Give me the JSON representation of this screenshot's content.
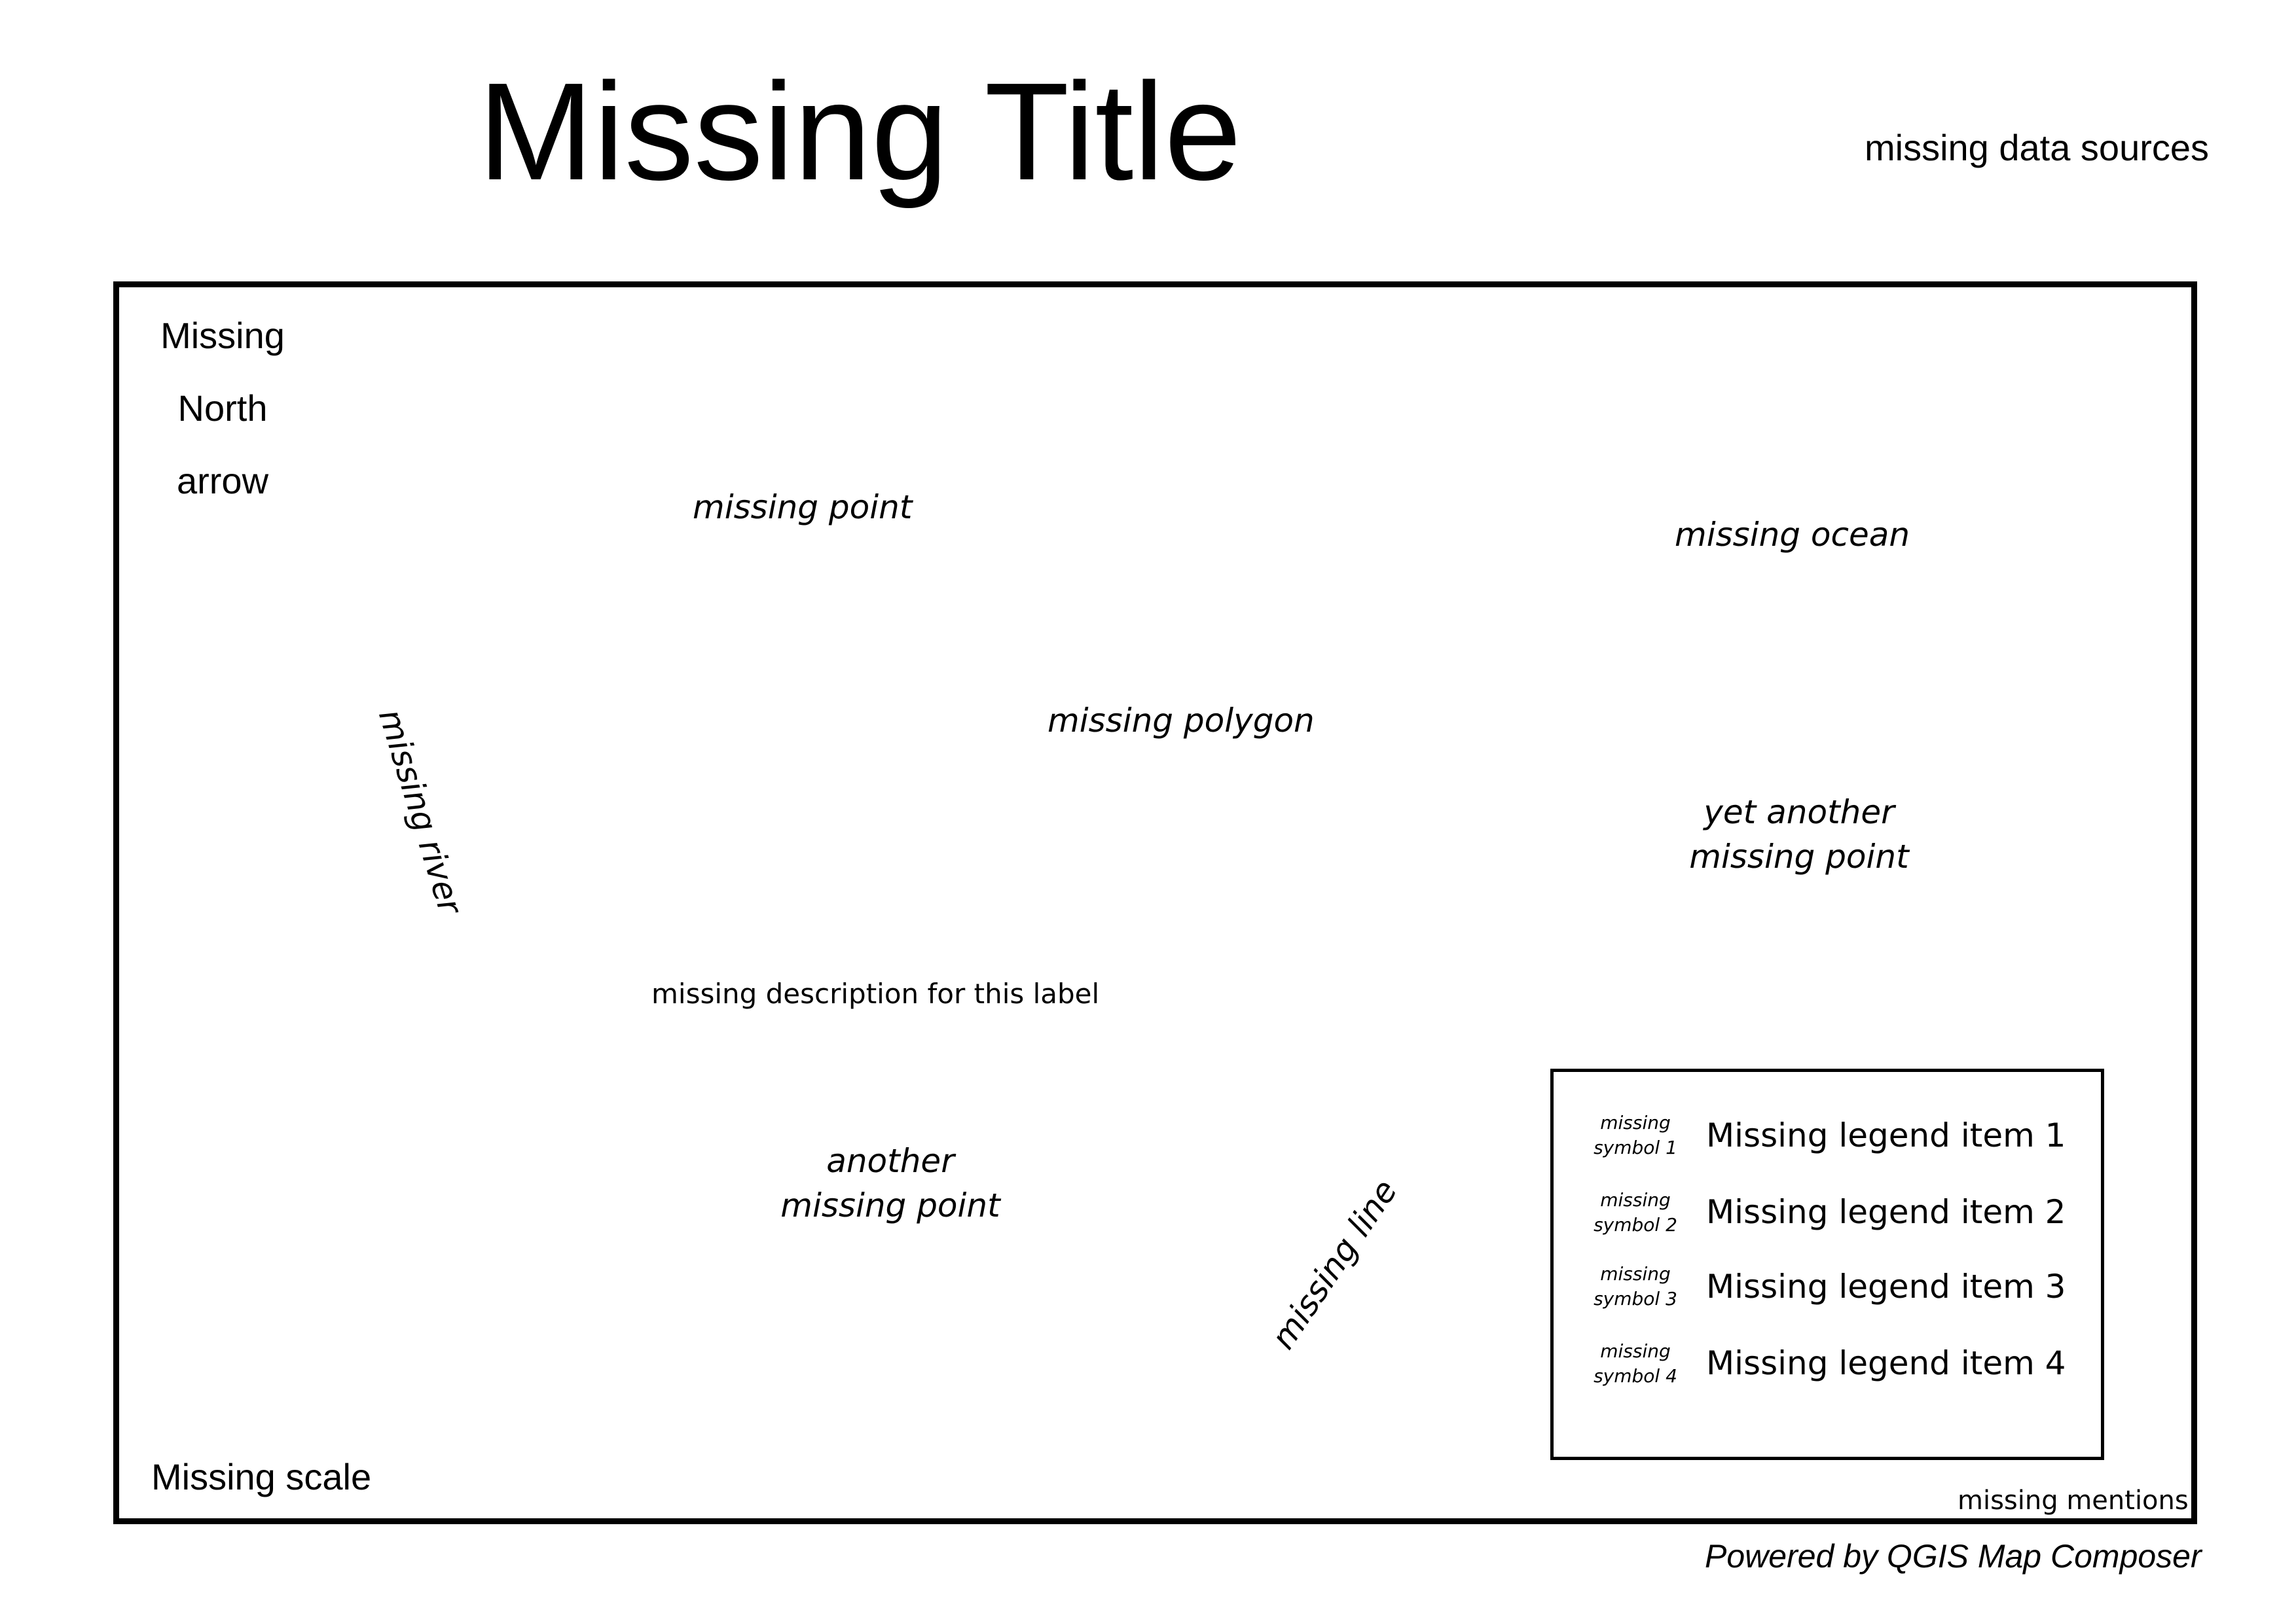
{
  "header": {
    "title": "Missing Title",
    "data_sources": "missing data sources"
  },
  "map": {
    "north_arrow": [
      "Missing",
      "North",
      "arrow"
    ],
    "labels": {
      "point": "missing point",
      "ocean": "missing ocean",
      "polygon": "missing polygon",
      "yet_another_point": "yet another missing point",
      "river": "missing river",
      "description": "missing description for this label",
      "another_point": "another missing point",
      "line": "missing line"
    },
    "legend": {
      "items": [
        {
          "symbol": "missing symbol 1",
          "label": "Missing legend item 1"
        },
        {
          "symbol": "missing symbol 2",
          "label": "Missing legend item 2"
        },
        {
          "symbol": "missing symbol 3",
          "label": "Missing legend item 3"
        },
        {
          "symbol": "missing symbol 4",
          "label": "Missing legend item 4"
        }
      ]
    },
    "scale": "Missing scale",
    "mentions": "missing mentions"
  },
  "footer": {
    "credit": "Powered by QGIS Map Composer"
  }
}
